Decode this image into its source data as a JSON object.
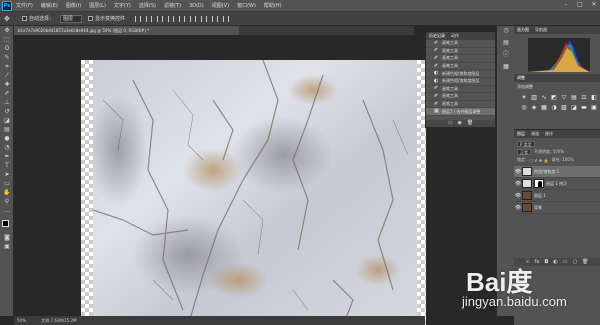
{
  "app": {
    "logo": "Ps"
  },
  "menu": [
    "文件(F)",
    "编辑(E)",
    "图像(I)",
    "图层(L)",
    "文字(Y)",
    "选择(S)",
    "滤镜(T)",
    "3D(D)",
    "视图(V)",
    "窗口(W)",
    "帮助(H)"
  ],
  "options": {
    "auto_select_label": "自动选择：",
    "auto_select_value": "图层",
    "transform_label": "显示变换控件"
  },
  "document": {
    "tab_title": "b1e7e7a9020b4d1857a3e0c8e944.jpg @ 50% (图层 0, RGB/8#) *",
    "status_zoom": "50%",
    "status_doc": "文档:7.63M/15.2M"
  },
  "history": {
    "tabs": [
      "历史记录",
      "动作"
    ],
    "items": [
      "画笔工具",
      "画笔工具",
      "画笔工具",
      "画笔工具",
      "新建色相/饱和度图层",
      "新建色相/饱和度图层",
      "画笔工具",
      "画笔工具",
      "画笔工具",
      "图层1 / 合并图层调整"
    ],
    "selected_index": 9
  },
  "panels": {
    "navigator_tabs": [
      "直方图",
      "导航器"
    ],
    "adjustments_title": "调整",
    "adjustments_subtitle": "添加调整",
    "layers_tabs": [
      "图层",
      "通道",
      "路径"
    ],
    "blend_mode": "正常",
    "opacity_label": "不透明度: 100%",
    "lock_label": "锁定:",
    "fill_label": "填充: 100%",
    "kind_label": "P 类型"
  },
  "layers": [
    {
      "name": "色相/饱和度 1",
      "visible": true,
      "type": "adjustment",
      "selected": true
    },
    {
      "name": "图层 1 拷贝",
      "visible": true,
      "type": "adjustment-mask",
      "selected": false
    },
    {
      "name": "图层 1",
      "visible": true,
      "type": "image",
      "selected": false
    },
    {
      "name": "背景",
      "visible": true,
      "type": "image",
      "selected": false
    }
  ],
  "watermark": {
    "brand": "Bai度",
    "url": "jingyan.baidu.com"
  },
  "colors": {
    "accent": "#31a8ff",
    "panel": "#535353",
    "workspace": "#282828"
  }
}
